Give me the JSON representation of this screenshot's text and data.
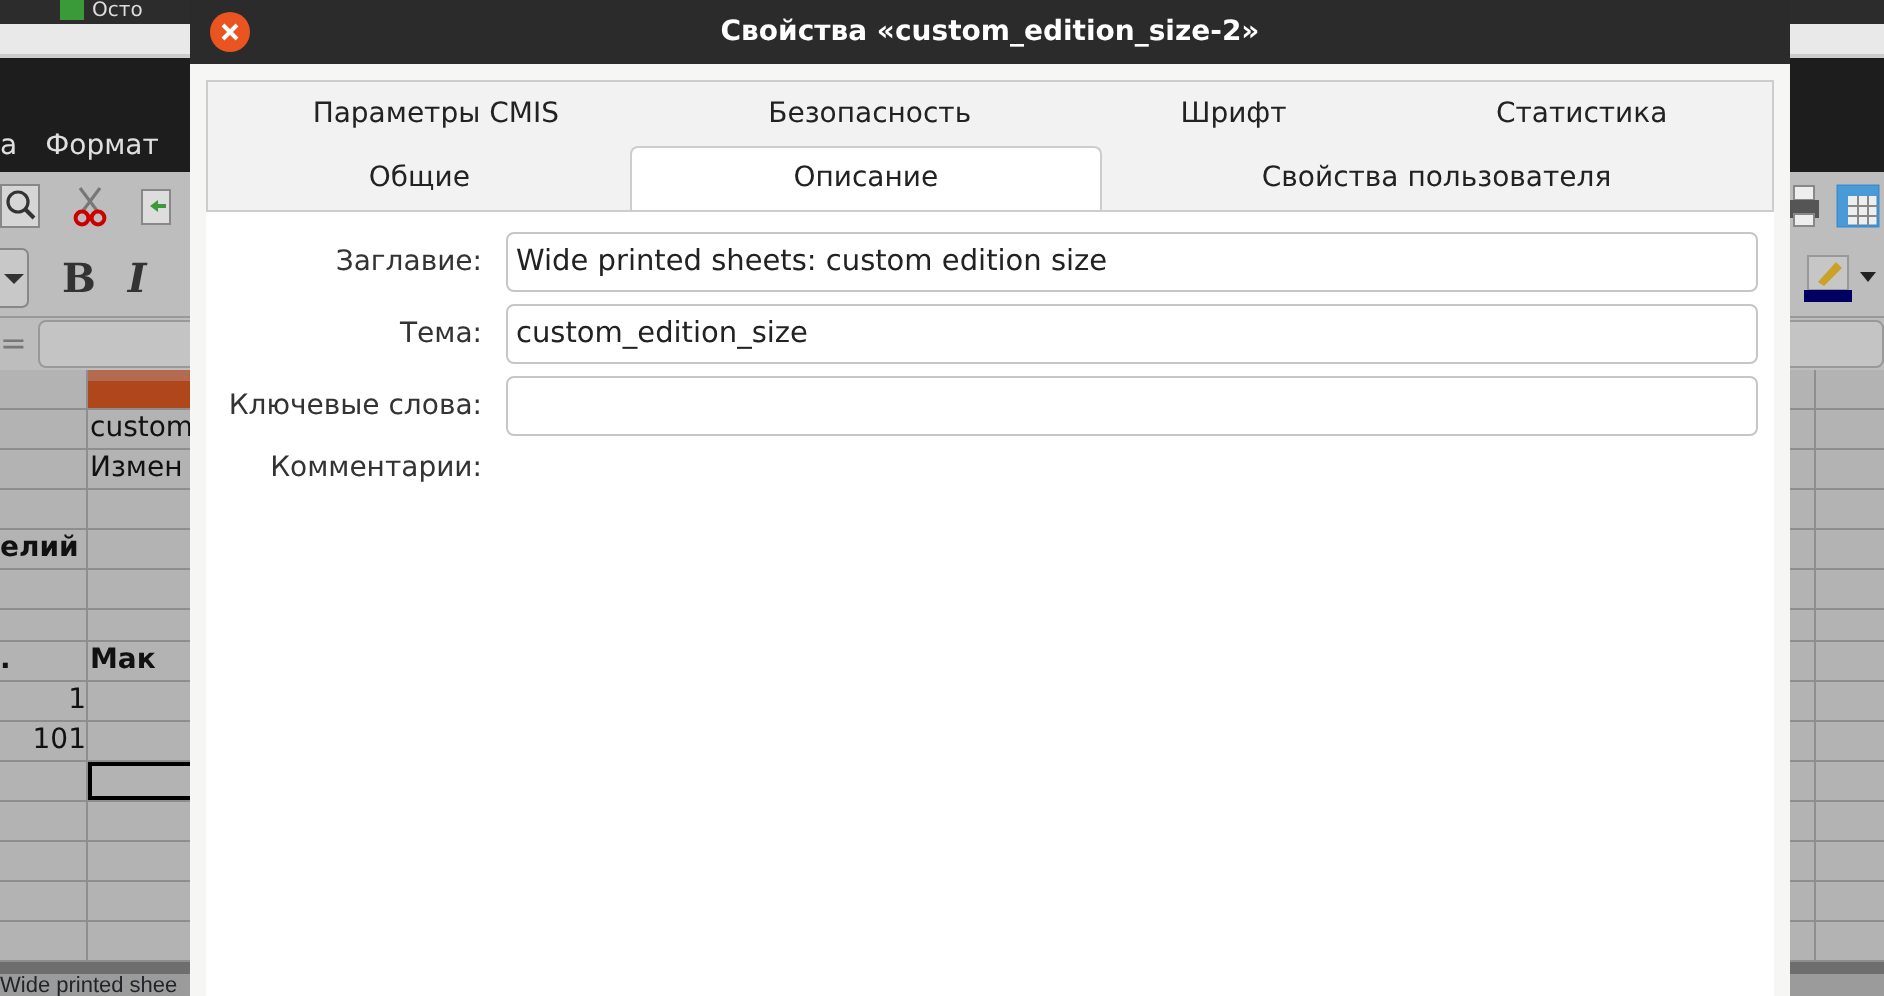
{
  "background": {
    "taskbar_tab": "Осто",
    "menu_items": [
      "а",
      "Формат"
    ],
    "format_glyphs": [
      "B",
      "I"
    ],
    "formula_sign": "=",
    "sheet_rows": [
      {
        "kind": "header"
      },
      {
        "b": "custom"
      },
      {
        "b": "Измен"
      },
      {},
      {
        "a": "елий",
        "bold": true
      },
      {},
      {
        "kind": "short"
      },
      {
        "a": ".",
        "b": "Мак",
        "bold": true
      },
      {
        "a": "1",
        "numeric": true
      },
      {
        "a": "101",
        "numeric": true
      },
      {
        "cursor": true
      },
      {},
      {},
      {},
      {}
    ],
    "status_text": "Wide printed shee"
  },
  "window": {
    "title": "Свойства «custom_edition_size-2»"
  },
  "tab_rows": [
    [
      {
        "label": "Параметры CMIS",
        "selected": false
      },
      {
        "label": "Безопасность",
        "selected": false
      },
      {
        "label": "Шрифт",
        "selected": false
      },
      {
        "label": "Статистика",
        "selected": false
      }
    ],
    [
      {
        "label": "Общие",
        "selected": false
      },
      {
        "label": "Описание",
        "selected": true
      },
      {
        "label": "Свойства пользователя",
        "selected": false
      }
    ]
  ],
  "fields": [
    {
      "kind": "text",
      "label": "Заглавие:",
      "value": "Wide printed sheets: custom edition size"
    },
    {
      "kind": "text",
      "label": "Тема:",
      "value": "custom_edition_size"
    },
    {
      "kind": "text",
      "label": "Ключевые слова:"
    },
    {
      "kind": "note",
      "label": "Комментарии:"
    }
  ]
}
